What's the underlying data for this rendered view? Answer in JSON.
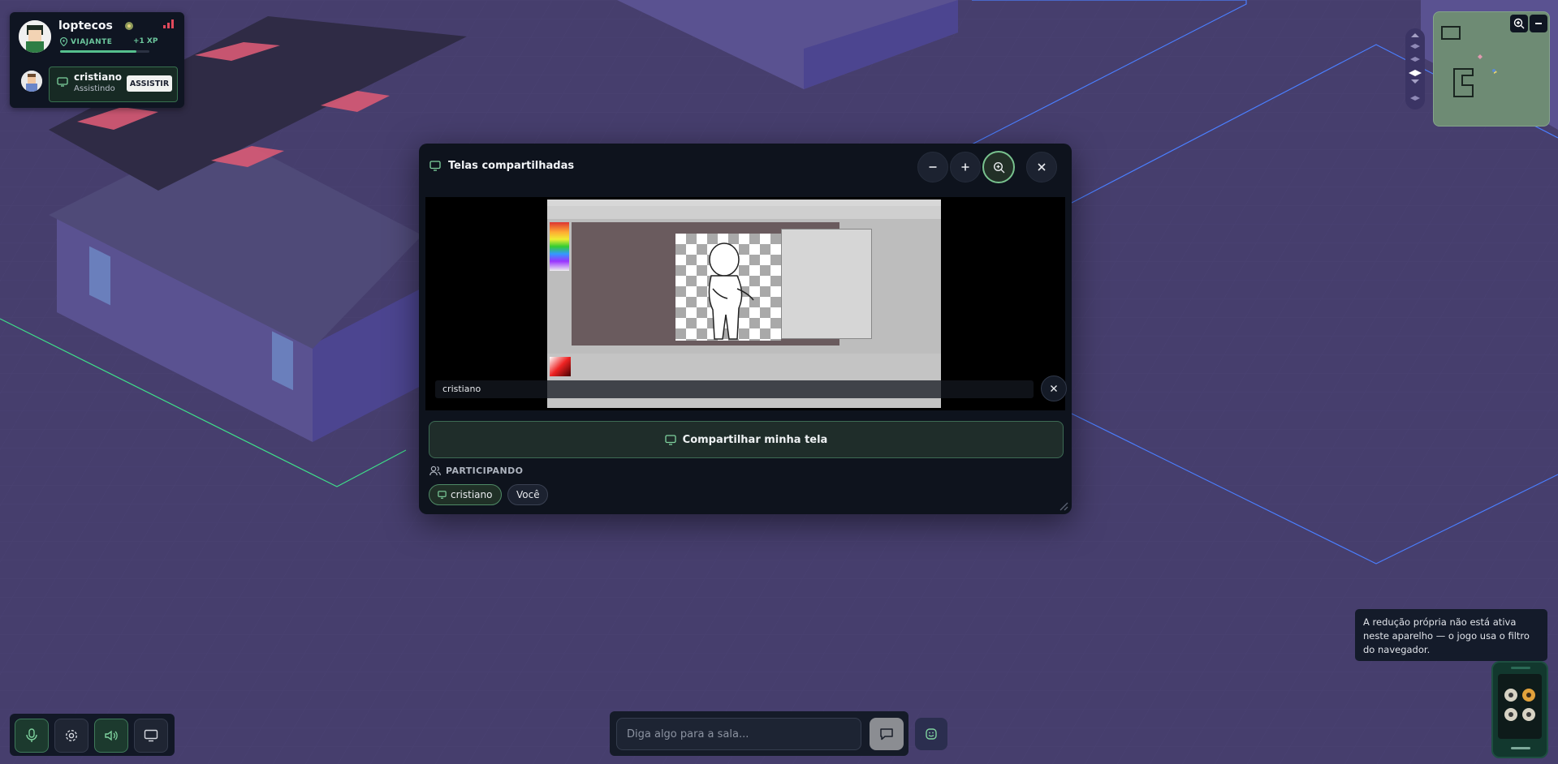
{
  "profile": {
    "username": "loptecos",
    "rank": "VIAJANTE",
    "xp": "+1 XP",
    "xp_progress": 0.85
  },
  "watcher": {
    "name": "cristiano",
    "status": "Assistindo",
    "button": "ASSISTIR"
  },
  "modal": {
    "title": "Telas compartilhadas",
    "zoom_out_icon": "minus-icon",
    "zoom_in_icon": "plus-icon",
    "zoom_fit_icon": "zoom-icon",
    "close_icon": "close-icon",
    "stream_name": "cristiano",
    "share_button": "Compartilhar minha tela",
    "participants_label": "PARTICIPANDO",
    "participants": [
      "cristiano",
      "Você"
    ]
  },
  "chat": {
    "placeholder": "Diga algo para a sala..."
  },
  "tooltip": {
    "text": "A redução própria não está ativa neste aparelho — o jogo usa o filtro do navegador."
  },
  "colors": {
    "background": "#463e6d",
    "panel": "#0e131d",
    "accent_green": "#56c08d",
    "floor_line_green": "#3ee08a",
    "floor_line_blue": "#4b7fff"
  }
}
